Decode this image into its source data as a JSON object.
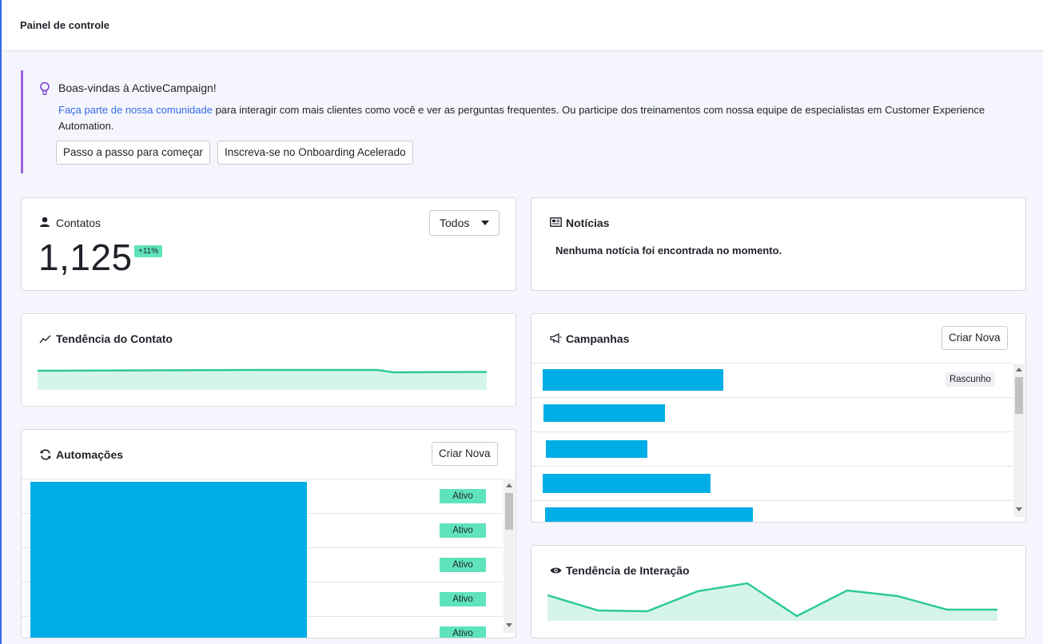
{
  "header": {
    "title": "Painel de controle"
  },
  "welcome": {
    "title": "Boas-vindas à ActiveCampaign!",
    "link_text": "Faça parte de nossa comunidade",
    "body_text": " para interagir com mais clientes como você e ver as perguntas frequentes. Ou participe dos treinamentos com nossa equipe de especialistas em Customer Experience Automation.",
    "button_start": "Passo a passo para começar",
    "button_onboarding": "Inscreva-se no Onboarding Acelerado"
  },
  "contacts": {
    "title": "Contatos",
    "filter": "Todos",
    "count": "1,125",
    "change": "+11%"
  },
  "news": {
    "title": "Notícias",
    "empty": "Nenhuma notícia foi encontrada no momento."
  },
  "contact_trend": {
    "title": "Tendência do Contato"
  },
  "campaigns": {
    "title": "Campanhas",
    "create_label": "Criar Nova",
    "rows": [
      {
        "status": "Rascunho"
      },
      {
        "status": ""
      },
      {
        "status": ""
      },
      {
        "status": ""
      },
      {
        "status": ""
      }
    ]
  },
  "automations": {
    "title": "Automações",
    "create_label": "Criar Nova",
    "rows": [
      {
        "status": "Ativo"
      },
      {
        "status": "Ativo"
      },
      {
        "status": "Ativo"
      },
      {
        "status": "Ativo"
      },
      {
        "status": "Ativo"
      }
    ]
  },
  "interaction_trend": {
    "title": "Tendência de Interação"
  },
  "colors": {
    "accent_purple": "#9b62e0",
    "link_blue": "#356ae6",
    "success_green": "#5ee3bd",
    "trend_line": "#2ec99b",
    "redaction_blue": "#00aee6"
  },
  "icons": {
    "welcome": "lightbulb-icon",
    "contacts": "user-icon",
    "news": "newspaper-icon",
    "contact_trend": "trend-line-icon",
    "campaigns": "megaphone-icon",
    "automations": "refresh-icon",
    "interaction_trend": "eye-icon"
  }
}
